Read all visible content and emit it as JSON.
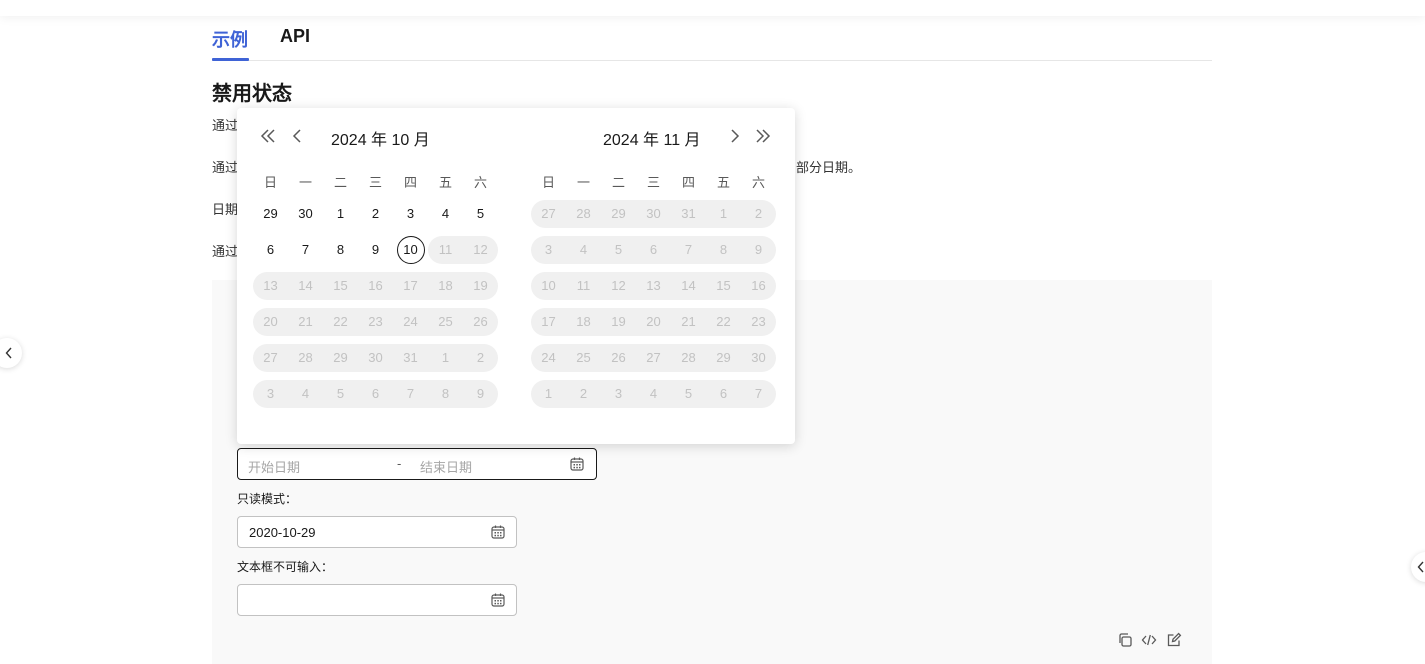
{
  "tabs": [
    {
      "label": "示例",
      "active": true
    },
    {
      "label": "API",
      "active": false
    }
  ],
  "section_title": "禁用状态",
  "descriptions": [
    "通过",
    "通过",
    "日期",
    "通过"
  ],
  "description_tail": "部分日期。",
  "calendar": {
    "left_title": "2024 年 10 月",
    "right_title": "2024 年 11 月",
    "weekdays": [
      "日",
      "一",
      "二",
      "三",
      "四",
      "五",
      "六"
    ],
    "today": "10",
    "left_weeks": [
      [
        "29",
        "30",
        "1",
        "2",
        "3",
        "4",
        "5"
      ],
      [
        "6",
        "7",
        "8",
        "9",
        "10",
        "11",
        "12"
      ],
      [
        "13",
        "14",
        "15",
        "16",
        "17",
        "18",
        "19"
      ],
      [
        "20",
        "21",
        "22",
        "23",
        "24",
        "25",
        "26"
      ],
      [
        "27",
        "28",
        "29",
        "30",
        "31",
        "1",
        "2"
      ],
      [
        "3",
        "4",
        "5",
        "6",
        "7",
        "8",
        "9"
      ]
    ],
    "right_weeks": [
      [
        "27",
        "28",
        "29",
        "30",
        "31",
        "1",
        "2"
      ],
      [
        "3",
        "4",
        "5",
        "6",
        "7",
        "8",
        "9"
      ],
      [
        "10",
        "11",
        "12",
        "13",
        "14",
        "15",
        "16"
      ],
      [
        "17",
        "18",
        "19",
        "20",
        "21",
        "22",
        "23"
      ],
      [
        "24",
        "25",
        "26",
        "27",
        "28",
        "29",
        "30"
      ],
      [
        "1",
        "2",
        "3",
        "4",
        "5",
        "6",
        "7"
      ]
    ]
  },
  "range_picker": {
    "start_placeholder": "开始日期",
    "separator": "-",
    "end_placeholder": "结束日期"
  },
  "readonly": {
    "label": "只读模式：",
    "value": "2020-10-29"
  },
  "no_input": {
    "label": "文本框不可输入：",
    "value": ""
  },
  "colors": {
    "accent": "#3f63d6",
    "disabled_text": "#c2c2c2",
    "disabled_bg": "#f0f0f0"
  }
}
